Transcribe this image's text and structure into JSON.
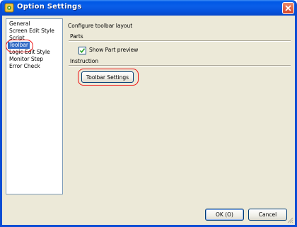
{
  "window": {
    "title": "Option Settings",
    "icon": "app-gear-icon"
  },
  "categories": {
    "items": [
      {
        "label": "General"
      },
      {
        "label": "Screen Edit Style"
      },
      {
        "label": "Script"
      },
      {
        "label": "Toolbar",
        "selected": true
      },
      {
        "label": "Logic Edit Style"
      },
      {
        "label": "Monitor Step"
      },
      {
        "label": "Error Check"
      }
    ]
  },
  "panel": {
    "heading": "Configure toolbar layout",
    "parts": {
      "label": "Parts",
      "show_part_preview": {
        "label": "Show Part preview",
        "checked": true
      }
    },
    "instruction": {
      "label": "Instruction",
      "toolbar_settings_button": "Toolbar Settings"
    }
  },
  "footer": {
    "ok_label": "OK (O)",
    "cancel_label": "Cancel"
  },
  "colors": {
    "titlebar": "#0058e6",
    "selection": "#316ac5",
    "highlight": "#ee1111",
    "dialog_bg": "#ece9d8"
  }
}
